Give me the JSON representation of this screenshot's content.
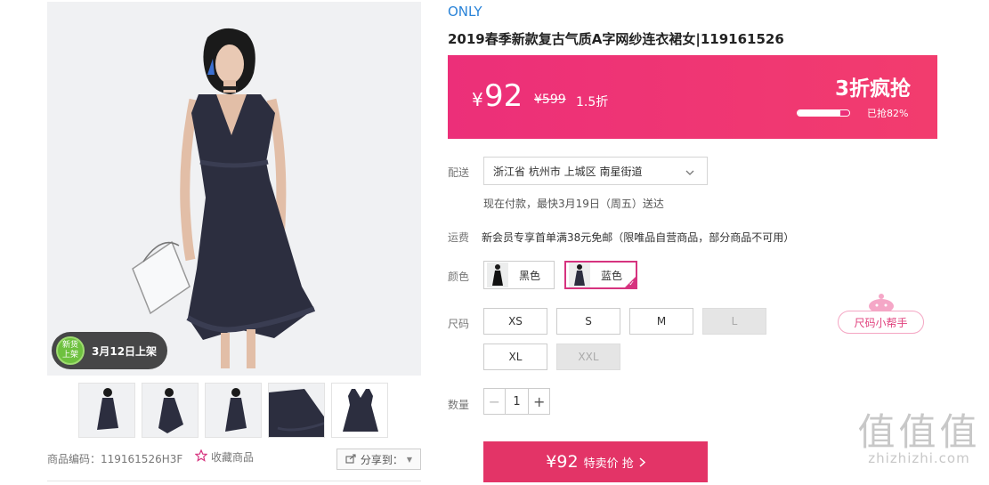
{
  "gallery": {
    "new_badge_line1": "新货",
    "new_badge_line2": "上架",
    "new_date": "3月12日上架",
    "thumb_count": 5
  },
  "meta": {
    "sku": "商品编码：119161526H3F",
    "favorite": "收藏商品",
    "share": "分享到："
  },
  "product": {
    "brand": "ONLY",
    "title": "2019春季新款复古气质A字网纱连衣裙女|119161526"
  },
  "price": {
    "currency": "¥",
    "current": "92",
    "original": "¥599",
    "discount": "1.5折",
    "promo": "3折疯抢",
    "sold_label": "已抢82%",
    "sold_fraction": 0.82
  },
  "delivery": {
    "label": "配送",
    "address": "浙江省 杭州市 上城区 南星街道",
    "note": "现在付款，最快3月19日（周五）送达"
  },
  "shipping": {
    "label": "运费",
    "text": "新会员专享首单满38元免邮（限唯品自营商品，部分商品不可用）"
  },
  "colors": {
    "label": "颜色",
    "options": [
      {
        "name": "黑色",
        "selected": false
      },
      {
        "name": "蓝色",
        "selected": true
      }
    ]
  },
  "sizes": {
    "label": "尺码",
    "options": [
      {
        "name": "XS",
        "available": true
      },
      {
        "name": "S",
        "available": true
      },
      {
        "name": "M",
        "available": true
      },
      {
        "name": "L",
        "available": false
      },
      {
        "name": "XL",
        "available": true
      },
      {
        "name": "XXL",
        "available": false
      }
    ],
    "helper": "尺码小帮手"
  },
  "quantity": {
    "label": "数量",
    "value": "1"
  },
  "buy": {
    "price": "¥92",
    "text": "特卖价 抢"
  },
  "watermark": {
    "big": "值值值",
    "url": "zhizhizhi.com"
  },
  "colors_theme": {
    "accent": "#ec2f79",
    "button": "#e33467",
    "brand_link": "#2b84d8"
  }
}
